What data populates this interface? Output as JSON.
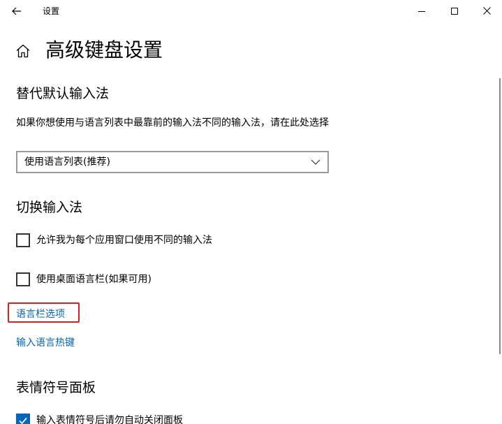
{
  "window": {
    "app_title": "设置",
    "controls": {
      "minimize": "minimize-icon",
      "maximize": "maximize-icon",
      "close": "close-icon"
    }
  },
  "header": {
    "title": "高级键盘设置",
    "home_icon": "home-icon",
    "back_icon": "back-arrow-icon"
  },
  "override_section": {
    "title": "替代默认输入法",
    "description": "如果你想使用与语言列表中最靠前的输入法不同的输入法，请在此处选择",
    "select": {
      "value": "使用语言列表(推荐)"
    }
  },
  "switch_section": {
    "title": "切换输入法",
    "checkboxes": [
      {
        "label": "允许我为每个应用窗口使用不同的输入法",
        "checked": false
      },
      {
        "label": "使用桌面语言栏(如果可用)",
        "checked": false
      }
    ],
    "links": [
      "语言栏选项",
      "输入语言热键"
    ]
  },
  "emoji_section": {
    "title": "表情符号面板",
    "checkboxes": [
      {
        "label": "输入表情符号后请勿自动关闭面板",
        "checked": true
      }
    ]
  },
  "colors": {
    "accent": "#0067c0",
    "highlight": "#e02020"
  }
}
